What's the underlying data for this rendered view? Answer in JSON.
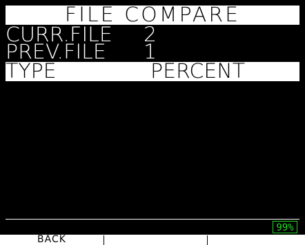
{
  "screen": {
    "title": "FILE COMPARE",
    "curr_file": {
      "label": "CURR.FILE",
      "value": "2"
    },
    "prev_file": {
      "label": "PREV.FILE",
      "value": "1"
    },
    "type": {
      "label": "TYPE",
      "value": "PERCENT"
    }
  },
  "status": {
    "battery": "99%"
  },
  "softkeys": {
    "key1": "BACK",
    "key2": "",
    "key3": ""
  },
  "colors": {
    "background": "#000000",
    "text": "#ffffff",
    "highlight_bar": "#ffffff",
    "battery": "#22dd22"
  }
}
